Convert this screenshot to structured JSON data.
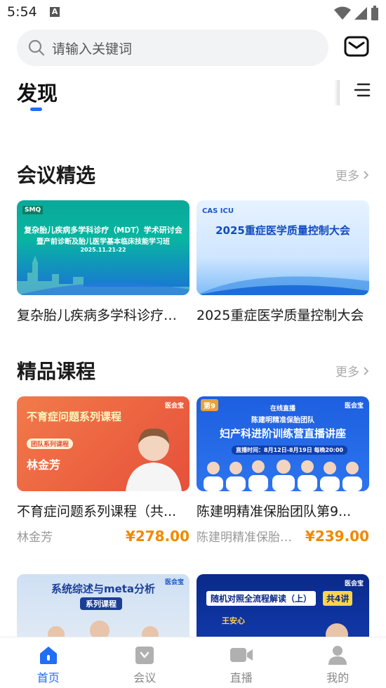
{
  "status_bar": {
    "time": "5:54",
    "notification_letter": "A"
  },
  "search": {
    "placeholder": "请输入关键词"
  },
  "tabs": {
    "active": "发现"
  },
  "sections": {
    "meetings": {
      "title": "会议精选",
      "more": "更多",
      "items": [
        {
          "title": "复杂胎儿疾病多学科诊疗（MDT）学术研讨会暨产前诊断及胎儿医学基本临床技能学习班",
          "thumb_heading": "复杂胎儿疾病多学科诊疗（MDT）学术研讨会",
          "thumb_sub": "暨产前诊断及胎儿医学基本临床技能学习班",
          "thumb_date": "2025.11.21-22",
          "thumb_logo": "SMQ"
        },
        {
          "title": "2025重症医学质量控制大会",
          "thumb_heading": "2025重症医学质量控制大会",
          "thumb_logo": "CAS ICU"
        }
      ]
    },
    "courses": {
      "title": "精品课程",
      "more": "更多",
      "items": [
        {
          "title": "不育症问题系列课程（共...",
          "lecturer": "林金芳",
          "price": "¥278.00",
          "thumb_heading": "不育症问题系列课程",
          "thumb_tag": "团队系列课程",
          "thumb_name": "林金芳",
          "thumb_brand": "医会宝"
        },
        {
          "title": "陈建明精准保胎团队第9...",
          "lecturer": "陈建明精准保胎团...",
          "price": "¥239.00",
          "thumb_heading": "妇产科进阶训练营直播讲座",
          "thumb_top": "陈建明精准保胎团队",
          "thumb_live": "在线直播",
          "thumb_time": "直播时间：8月12日-8月19日 每晚20:00",
          "thumb_badge": "第9",
          "thumb_brand": "医会宝"
        },
        {
          "thumb_heading": "系统综述与meta分析",
          "thumb_sub": "系列课程",
          "thumb_brand": "医会宝"
        },
        {
          "thumb_heading": "随机对照全流程解读（上）",
          "thumb_badge": "共4讲",
          "thumb_name": "王安心",
          "thumb_brand": "医会宝"
        }
      ]
    }
  },
  "bottom_nav": [
    {
      "label": "首页",
      "icon": "home-icon",
      "active": true
    },
    {
      "label": "会议",
      "icon": "meeting-icon",
      "active": false
    },
    {
      "label": "直播",
      "icon": "video-icon",
      "active": false
    },
    {
      "label": "我的",
      "icon": "user-icon",
      "active": false
    }
  ],
  "colors": {
    "accent": "#1f6ef5",
    "price": "#f08a00",
    "more": "#aaaaaa"
  }
}
